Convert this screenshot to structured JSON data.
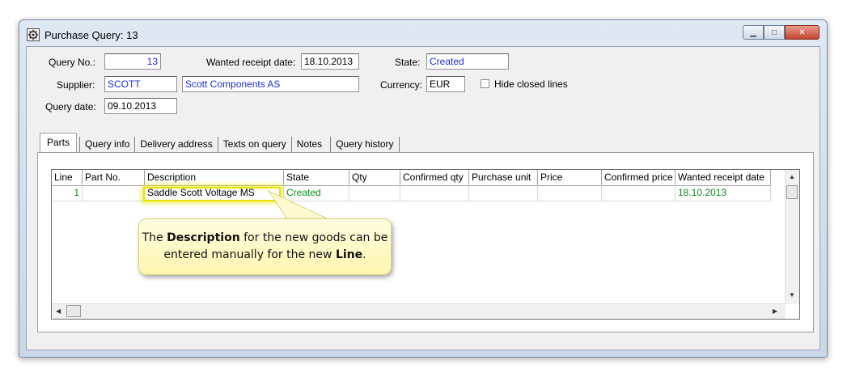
{
  "window": {
    "title": "Purchase Query: 13",
    "buttons": {
      "minimize": "▁",
      "maximize": "□",
      "close": "✕"
    }
  },
  "form": {
    "query_no_label": "Query No.:",
    "query_no": "13",
    "wanted_receipt_date_label": "Wanted receipt date:",
    "wanted_receipt_date": "18.10.2013",
    "state_label": "State:",
    "state": "Created",
    "supplier_label": "Supplier:",
    "supplier_code": "SCOTT",
    "supplier_name": "Scott Components AS",
    "currency_label": "Currency:",
    "currency": "EUR",
    "hide_closed_label": "Hide closed lines",
    "hide_closed_checked": false,
    "query_date_label": "Query date:",
    "query_date": "09.10.2013"
  },
  "tabs": [
    "Parts",
    "Query info",
    "Delivery address",
    "Texts on query",
    "Notes",
    "Query history"
  ],
  "active_tab": "Parts",
  "grid": {
    "columns": [
      "Line",
      "Part No.",
      "Description",
      "State",
      "Qty",
      "Confirmed qty",
      "Purchase unit",
      "Price",
      "Confirmed price",
      "Wanted receipt date"
    ],
    "rows": [
      {
        "line": "1",
        "part_no": "",
        "description": "Saddle Scott Voltage MS",
        "state": "Created",
        "qty": "",
        "confirmed_qty": "",
        "purchase_unit": "",
        "price": "",
        "confirmed_price": "",
        "wanted_receipt_date": "18.10.2013"
      }
    ]
  },
  "callout": {
    "part1": "The ",
    "bold1": "Description",
    "part2": " for the new goods can be entered manually for the new ",
    "bold2": "Line",
    "part3": "."
  },
  "colors": {
    "value_blue": "#1f2fd1",
    "value_green": "#0c8a1e",
    "callout_bg": "#fff6b0",
    "highlight": "#e6e400"
  }
}
